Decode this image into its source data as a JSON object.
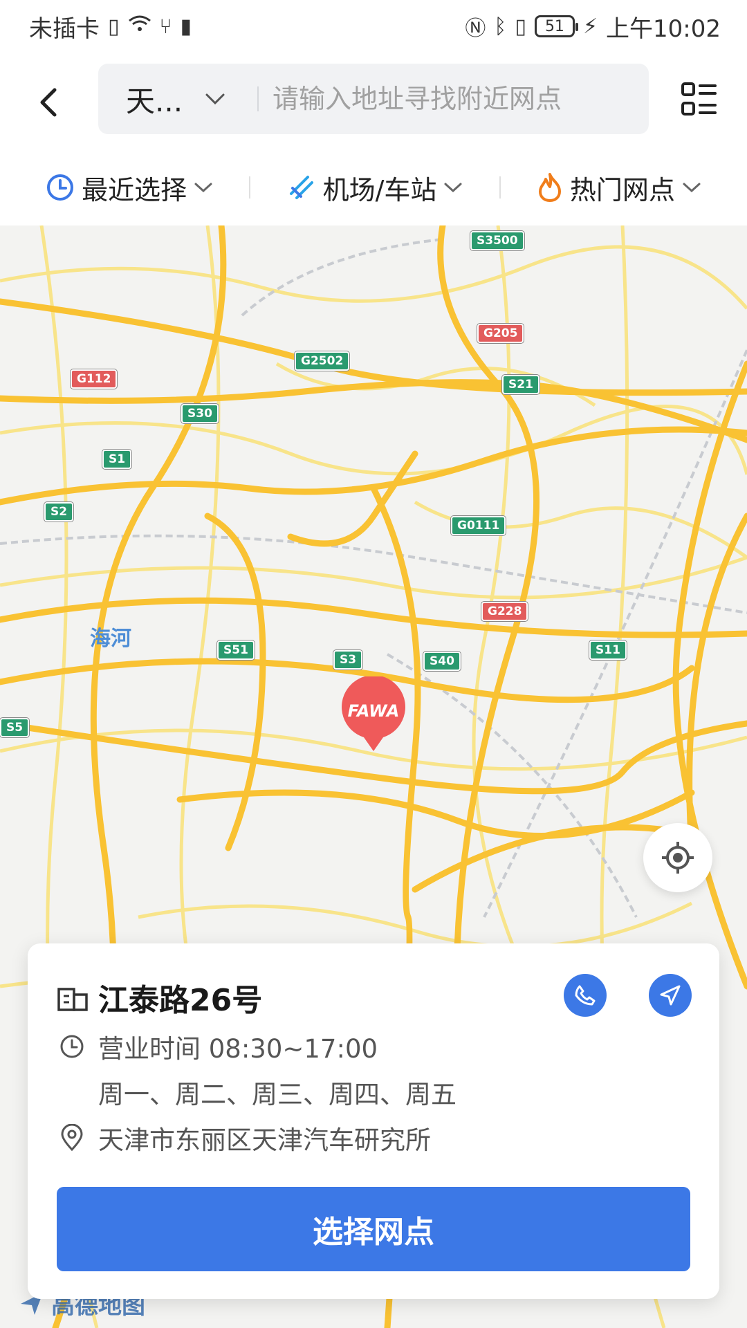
{
  "status_bar": {
    "carrier": "未插卡",
    "battery": "51",
    "time": "上午10:02"
  },
  "header": {
    "city": "天...",
    "search_placeholder": "请输入地址寻找附近网点"
  },
  "filters": [
    {
      "label": "最近选择",
      "icon": "clock-icon"
    },
    {
      "label": "机场/车站",
      "icon": "plane-icon"
    },
    {
      "label": "热门网点",
      "icon": "flame-icon"
    }
  ],
  "map": {
    "place_label": "海河",
    "logo_text": "高德地图",
    "pin_text": "FAWA",
    "road_labels": [
      "S3500",
      "G205",
      "G2502",
      "G112",
      "S21",
      "S30",
      "S1",
      "S2",
      "G0111",
      "G228",
      "S51",
      "S3",
      "S40",
      "S11",
      "S5"
    ]
  },
  "card": {
    "title": "江泰路26号",
    "hours": "营业时间 08:30~17:00",
    "days": "周一、周二、周三、周四、周五",
    "address": "天津市东丽区天津汽车研究所",
    "select_button": "选择网点"
  },
  "colors": {
    "accent_blue": "#3c78e6",
    "road_yellow": "#f9c233",
    "pin_red": "#ef5a5a",
    "flame_orange": "#f07d1a"
  }
}
